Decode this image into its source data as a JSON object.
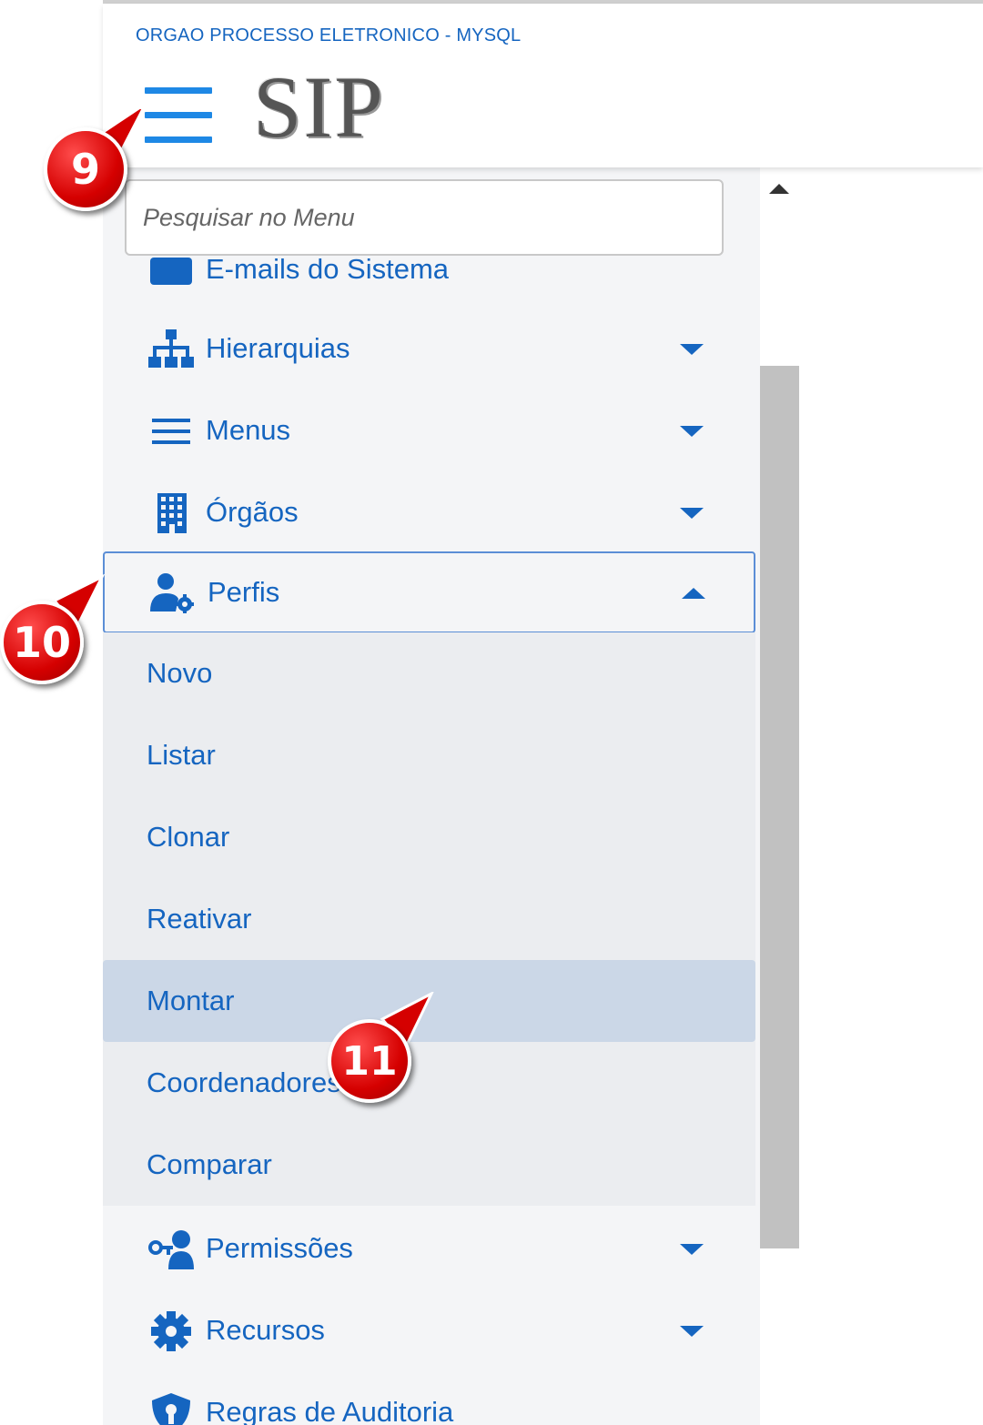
{
  "header": {
    "org_name": "ORGAO PROCESSO ELETRONICO - MYSQL",
    "logo_text": "SIP",
    "menu_icon": "hamburger-icon"
  },
  "sidebar": {
    "search_placeholder": "Pesquisar no Menu",
    "partial_item": "E-mails do Sistema",
    "items": [
      {
        "label": "Hierarquias",
        "icon": "sitemap-icon",
        "expanded": false
      },
      {
        "label": "Menus",
        "icon": "bars-icon",
        "expanded": false
      },
      {
        "label": "Órgãos",
        "icon": "building-icon",
        "expanded": false
      },
      {
        "label": "Perfis",
        "icon": "user-gear-icon",
        "expanded": true
      },
      {
        "label": "Permissões",
        "icon": "user-key-icon",
        "expanded": false
      },
      {
        "label": "Recursos",
        "icon": "gear-icon",
        "expanded": false
      },
      {
        "label": "Regras de Auditoria",
        "icon": "shield-key-icon",
        "expanded": false
      }
    ],
    "perfis_submenu": [
      "Novo",
      "Listar",
      "Clonar",
      "Reativar",
      "Montar",
      "Coordenadores",
      "Comparar"
    ],
    "selected_submenu": "Montar"
  },
  "annotations": [
    "9",
    "10",
    "11"
  ],
  "colors": {
    "accent": "#1565c0",
    "hamburger": "#1e88e5",
    "marker": "#d50000",
    "selected_bg": "#cbd7e7"
  }
}
